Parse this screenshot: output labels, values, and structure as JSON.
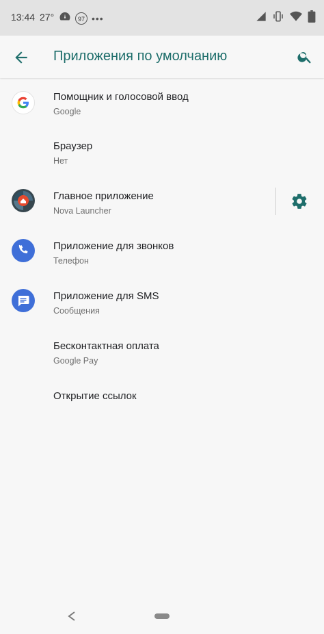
{
  "status_bar": {
    "time": "13:44",
    "temperature": "27°",
    "badge_value": "97",
    "more_dots": "•••"
  },
  "app_bar": {
    "title": "Приложения по умолчанию",
    "back_icon": "arrow-back-icon",
    "search_icon": "search-icon",
    "accent_color": "#1e6e6b"
  },
  "items": [
    {
      "title": "Помощник и голосовой ввод",
      "subtitle": "Google",
      "icon": "google-icon"
    },
    {
      "title": "Браузер",
      "subtitle": "Нет",
      "icon": ""
    },
    {
      "title": "Главное приложение",
      "subtitle": "Nova Launcher",
      "icon": "nova-launcher-icon",
      "has_settings": true
    },
    {
      "title": "Приложение для звонков",
      "subtitle": "Телефон",
      "icon": "phone-icon"
    },
    {
      "title": "Приложение для SMS",
      "subtitle": "Сообщения",
      "icon": "messages-icon"
    },
    {
      "title": "Бесконтактная оплата",
      "subtitle": "Google Pay",
      "icon": ""
    },
    {
      "title": "Открытие ссылок",
      "subtitle": "",
      "icon": ""
    }
  ],
  "nav_bar": {
    "back_icon": "nav-back-icon",
    "home_icon": "nav-home-pill-icon"
  }
}
